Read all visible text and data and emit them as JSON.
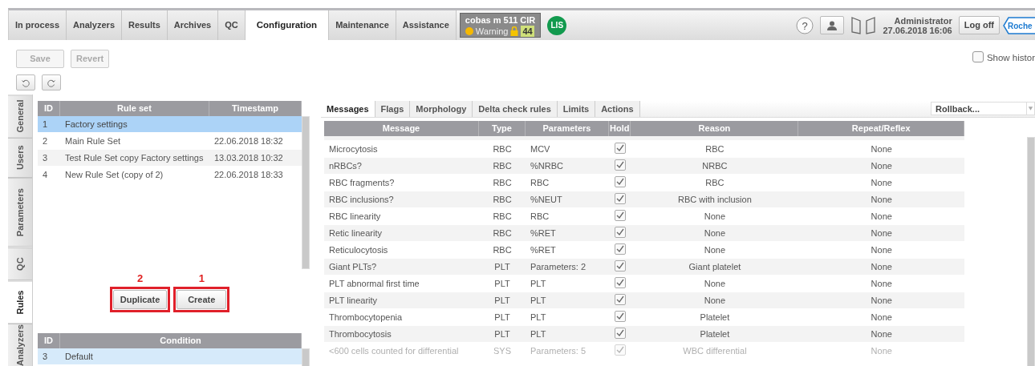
{
  "main_tabs": [
    {
      "label": "In process",
      "selected": false
    },
    {
      "label": "Analyzers",
      "selected": false
    },
    {
      "label": "Results",
      "selected": false
    },
    {
      "label": "Archives",
      "selected": false
    },
    {
      "label": "QC",
      "selected": false
    },
    {
      "label": "Configuration",
      "selected": true
    },
    {
      "label": "Maintenance",
      "selected": false
    },
    {
      "label": "Assistance",
      "selected": false
    }
  ],
  "instrument": {
    "name": "cobas m 511 CIR",
    "status": "Warning",
    "count": "44",
    "lis": "LIS"
  },
  "user": {
    "help": "?",
    "name": "Administrator",
    "datetime": "27.06.2018 16:06",
    "logoff": "Log off",
    "logo": "Roche"
  },
  "toolbar": {
    "buttons": [
      {
        "label": "Save",
        "disabled": true
      },
      {
        "label": "Revert",
        "disabled": true
      }
    ],
    "show_history": {
      "label": "Show histor",
      "checked": false
    }
  },
  "side_tabs": [
    {
      "label": "General",
      "selected": false
    },
    {
      "label": "Users",
      "selected": false
    },
    {
      "label": "Parameters",
      "selected": false
    },
    {
      "label": "QC",
      "selected": false
    },
    {
      "label": "Rules",
      "selected": true
    },
    {
      "label": "Analyzers",
      "selected": false
    }
  ],
  "rule_sets": {
    "focused": true,
    "columns": [
      "ID",
      "Rule set",
      "Timestamp"
    ],
    "rows": [
      {
        "id": "1",
        "name": "Factory settings",
        "timestamp": "",
        "selected": true
      },
      {
        "id": "2",
        "name": "Main Rule Set",
        "timestamp": "22.06.2018 18:32",
        "selected": false
      },
      {
        "id": "3",
        "name": "Test Rule Set copy Factory settings",
        "timestamp": "13.03.2018 10:32",
        "selected": false
      },
      {
        "id": "4",
        "name": "New Rule Set (copy of 2)",
        "timestamp": "22.06.2018 18:33",
        "selected": false
      }
    ]
  },
  "rule_buttons": [
    {
      "label": "Duplicate",
      "annotation": "2"
    },
    {
      "label": "Create",
      "annotation": "1"
    }
  ],
  "conditions": {
    "focused": false,
    "columns": [
      "ID",
      "Condition"
    ],
    "rows": [
      {
        "id": "3",
        "name": "Default",
        "selected": true
      }
    ]
  },
  "detail_tabs": [
    {
      "label": "Messages",
      "selected": true
    },
    {
      "label": "Flags",
      "selected": false
    },
    {
      "label": "Morphology",
      "selected": false
    },
    {
      "label": "Delta check rules",
      "selected": false
    },
    {
      "label": "Limits",
      "selected": false
    },
    {
      "label": "Actions",
      "selected": false
    }
  ],
  "rollback": {
    "value": "Rollback..."
  },
  "messages": {
    "columns": [
      "Message",
      "Type",
      "Parameters",
      "Hold",
      "Reason",
      "Repeat/Reflex"
    ],
    "rows": [
      {
        "message": "Microcytosis",
        "type": "RBC",
        "parameters": "MCV",
        "hold": true,
        "reason": "RBC",
        "repeat": "None",
        "disabled": false
      },
      {
        "message": "nRBCs?",
        "type": "RBC",
        "parameters": "%NRBC",
        "hold": true,
        "reason": "NRBC",
        "repeat": "None",
        "disabled": false
      },
      {
        "message": "RBC fragments?",
        "type": "RBC",
        "parameters": "RBC",
        "hold": true,
        "reason": "RBC",
        "repeat": "None",
        "disabled": false
      },
      {
        "message": "RBC inclusions?",
        "type": "RBC",
        "parameters": "%NEUT",
        "hold": true,
        "reason": "RBC with inclusion",
        "repeat": "None",
        "disabled": false
      },
      {
        "message": "RBC linearity",
        "type": "RBC",
        "parameters": "RBC",
        "hold": true,
        "reason": "None",
        "repeat": "None",
        "disabled": false
      },
      {
        "message": "Retic linearity",
        "type": "RBC",
        "parameters": "%RET",
        "hold": true,
        "reason": "None",
        "repeat": "None",
        "disabled": false
      },
      {
        "message": "Reticulocytosis",
        "type": "RBC",
        "parameters": "%RET",
        "hold": true,
        "reason": "None",
        "repeat": "None",
        "disabled": false
      },
      {
        "message": "Giant PLTs?",
        "type": "PLT",
        "parameters": "Parameters: 2",
        "hold": true,
        "reason": "Giant platelet",
        "repeat": "None",
        "disabled": false
      },
      {
        "message": "PLT abnormal first time",
        "type": "PLT",
        "parameters": "PLT",
        "hold": true,
        "reason": "None",
        "repeat": "None",
        "disabled": false
      },
      {
        "message": "PLT linearity",
        "type": "PLT",
        "parameters": "PLT",
        "hold": true,
        "reason": "None",
        "repeat": "None",
        "disabled": false
      },
      {
        "message": "Thrombocytopenia",
        "type": "PLT",
        "parameters": "PLT",
        "hold": true,
        "reason": "Platelet",
        "repeat": "None",
        "disabled": false
      },
      {
        "message": "Thrombocytosis",
        "type": "PLT",
        "parameters": "PLT",
        "hold": true,
        "reason": "Platelet",
        "repeat": "None",
        "disabled": false
      },
      {
        "message": "<600 cells counted for differential",
        "type": "SYS",
        "parameters": "Parameters: 5",
        "hold": true,
        "reason": "WBC differential",
        "repeat": "None",
        "disabled": true
      }
    ]
  }
}
